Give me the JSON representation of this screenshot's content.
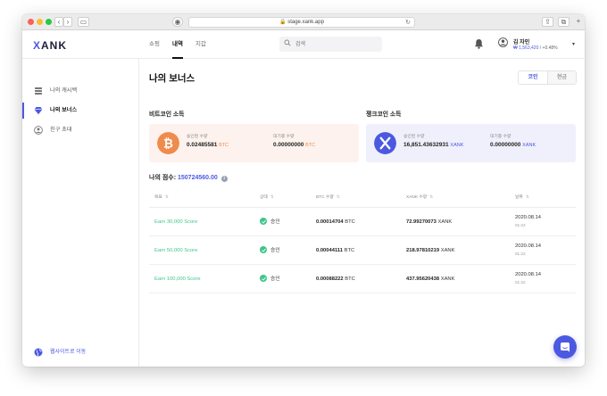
{
  "browser": {
    "url": "stage.xank.app"
  },
  "header": {
    "logo": "XANK",
    "nav": [
      {
        "label": "쇼핑"
      },
      {
        "label": "내역"
      },
      {
        "label": "지갑"
      }
    ],
    "search_placeholder": "검색",
    "user": {
      "name": "김 자인",
      "balance": "₩ 1,563,420",
      "change": "/ +0.48%"
    }
  },
  "sidebar": {
    "items": [
      {
        "label": "나의 캐시백",
        "icon": "stack-icon"
      },
      {
        "label": "나의 보너스",
        "icon": "gem-icon"
      },
      {
        "label": "친구 초대",
        "icon": "user-circle-icon"
      }
    ],
    "footer": "웹사이트로 이동"
  },
  "main": {
    "title": "나의 보너스",
    "toggle": [
      "코인",
      "현금"
    ],
    "btc_section": {
      "title": "비트코인 소득",
      "approved_label": "승인된 수량",
      "approved_value": "0.02485581",
      "approved_unit": "BTC",
      "pending_label": "대기중 수량",
      "pending_value": "0.00000000",
      "pending_unit": "BTC"
    },
    "xank_section": {
      "title": "쟁크코인 소득",
      "approved_label": "승인된 수량",
      "approved_value": "16,851.43632931",
      "approved_unit": "XANK",
      "pending_label": "대기중 수량",
      "pending_value": "0.00000000",
      "pending_unit": "XANK"
    },
    "score_label": "나의 점수:",
    "score_value": "150724560.00",
    "table": {
      "headers": [
        "목표",
        "상태",
        "BTC 수량",
        "XANK 수량",
        "날짜"
      ],
      "rows": [
        {
          "goal": "Earn 30,000 Score",
          "status": "승인",
          "btc": "0.00014704",
          "btc_unit": "BTC",
          "xank": "72.99270073",
          "xank_unit": "XANK",
          "date": "2020.08.14",
          "time": "01:22"
        },
        {
          "goal": "Earn 50,000 Score",
          "status": "승인",
          "btc": "0.00044111",
          "btc_unit": "BTC",
          "xank": "218.97810219",
          "xank_unit": "XANK",
          "date": "2020.08.14",
          "time": "01:22"
        },
        {
          "goal": "Earn 100,000 Score",
          "status": "승인",
          "btc": "0.00088222",
          "btc_unit": "BTC",
          "xank": "437.95620438",
          "xank_unit": "XANK",
          "date": "2020.08.14",
          "time": "01:22"
        }
      ]
    }
  },
  "colors": {
    "accent": "#4b59e0",
    "btc": "#ef8b4c",
    "success": "#3fc68a"
  }
}
